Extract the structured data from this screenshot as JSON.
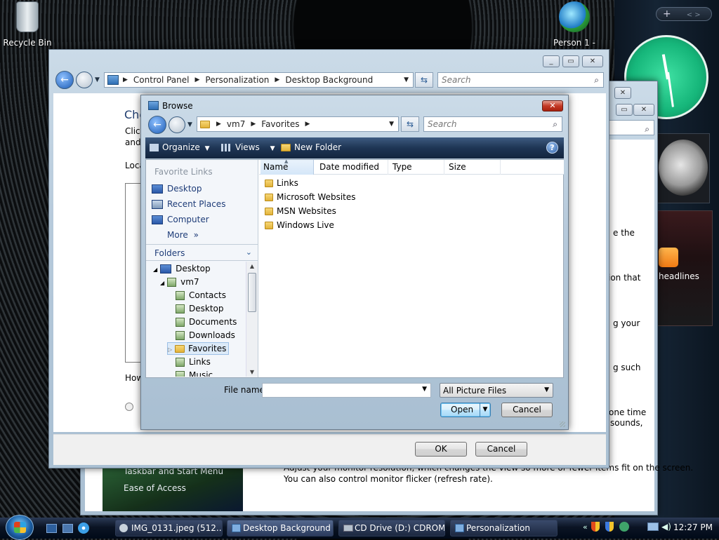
{
  "desktop": {
    "recycle_bin": "Recycle Bin",
    "person": "Person 1 -"
  },
  "gadgets": {
    "headlines": "headlines"
  },
  "main_window": {
    "breadcrumb": [
      "Control Panel",
      "Personalization",
      "Desktop Background"
    ],
    "search_placeholder": "Search",
    "heading": "Cho",
    "text1": "Click",
    "text2": "and",
    "loc": "Loca",
    "how": "How",
    "ok": "OK",
    "cancel": "Cancel"
  },
  "back_window": {
    "frag1": "e the",
    "frag2": "ion that",
    "frag3": "g your",
    "frag4": "g such",
    "frag5": "one time",
    "frag6": "sounds,",
    "links": [
      "Taskbar and Start Menu",
      "Ease of Access"
    ],
    "para1": "Adjust your monitor resolution, which changes the view so more or fewer items fit on the screen.",
    "para2": "You can also control monitor flicker (refresh rate)."
  },
  "browse": {
    "title": "Browse",
    "breadcrumb": [
      "vm7",
      "Favorites"
    ],
    "search_placeholder": "Search",
    "toolbar": {
      "organize": "Organize",
      "views": "Views",
      "new_folder": "New Folder"
    },
    "favorite_links_header": "Favorite Links",
    "favorite_links": [
      "Desktop",
      "Recent Places",
      "Computer"
    ],
    "more": "More",
    "folders_header": "Folders",
    "tree": [
      "Desktop",
      "vm7",
      "Contacts",
      "Desktop",
      "Documents",
      "Downloads",
      "Favorites",
      "Links",
      "Music"
    ],
    "columns": [
      "Name",
      "Date modified",
      "Type",
      "Size"
    ],
    "files": [
      "Links",
      "Microsoft Websites",
      "MSN Websites",
      "Windows Live"
    ],
    "file_name_label": "File name:",
    "file_name_value": "",
    "filter": "All Picture Files",
    "open": "Open",
    "cancel": "Cancel"
  },
  "taskbar": {
    "buttons": [
      "IMG_0131.jpeg (512...",
      "Desktop Background",
      "CD Drive (D:) CDROM",
      "Personalization"
    ],
    "clock": "12:27 PM"
  }
}
